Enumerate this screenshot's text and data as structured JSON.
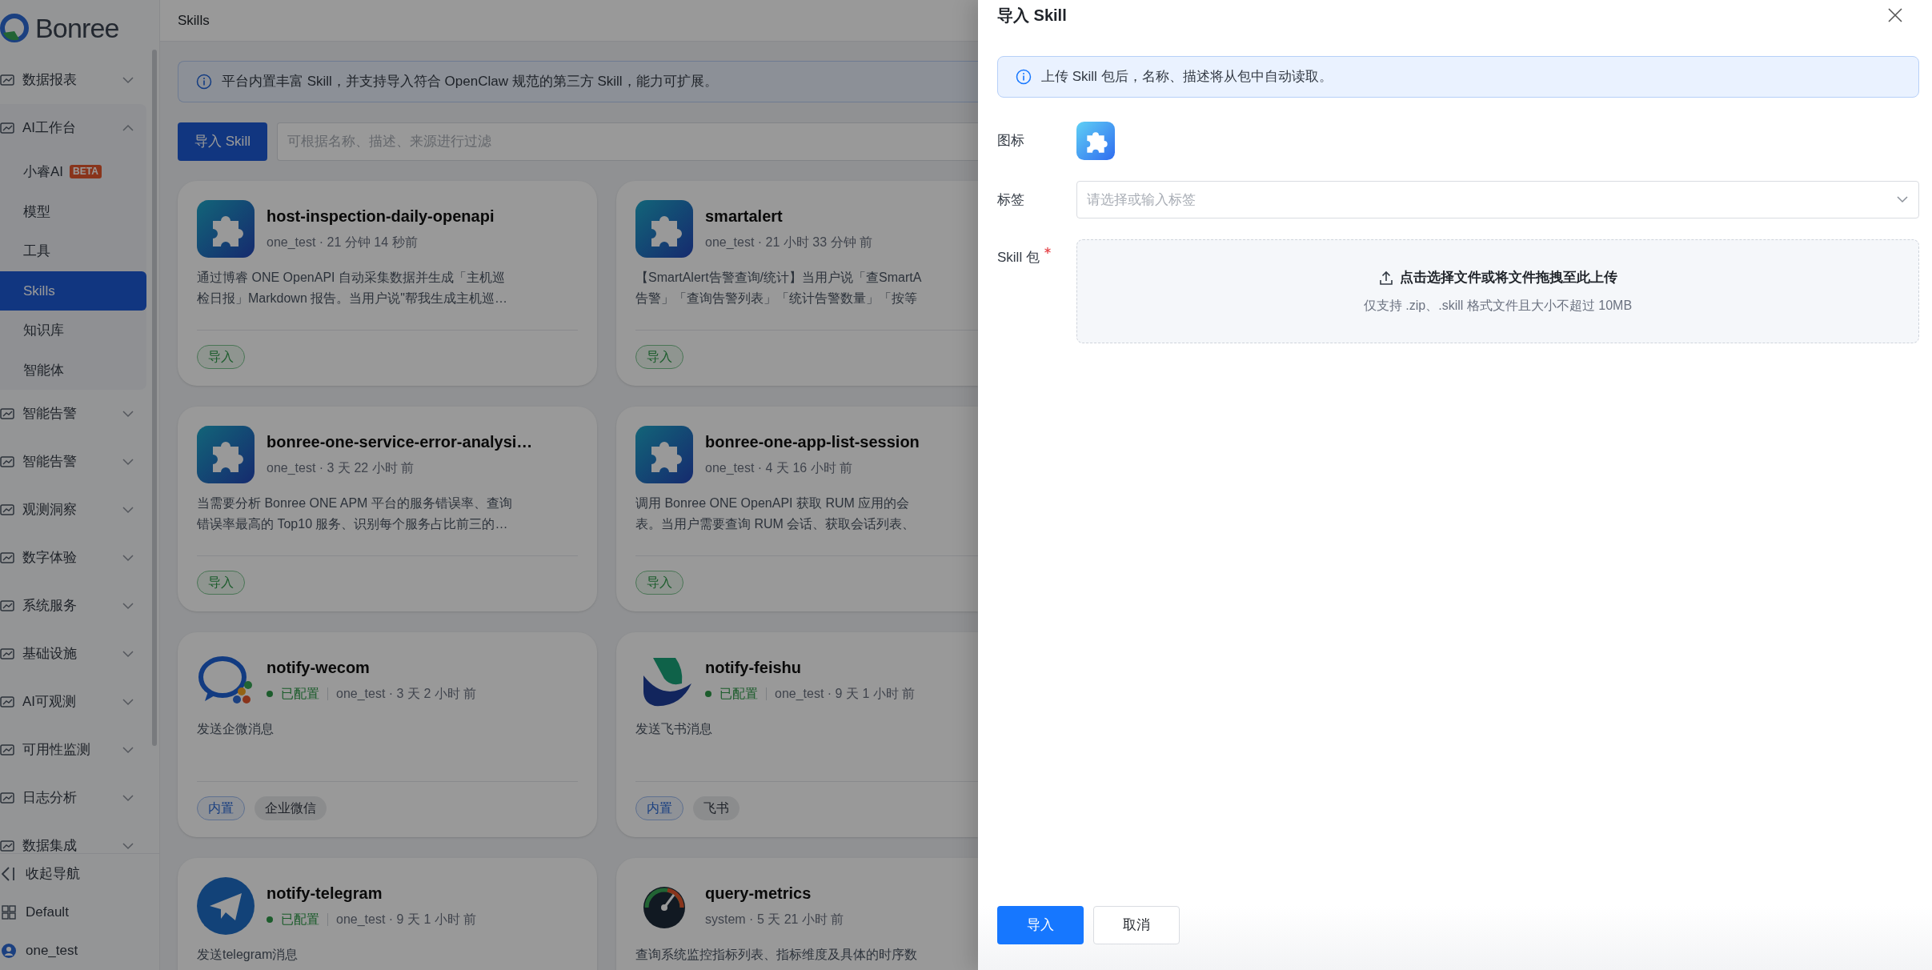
{
  "sidebar": {
    "logo": "Bonree",
    "nav": [
      {
        "label": "数据报表",
        "expanded": false
      },
      {
        "label": "AI工作台",
        "expanded": true,
        "children": [
          {
            "label": "小睿AI",
            "badge": "BETA",
            "selected": false
          },
          {
            "label": "模型",
            "selected": false
          },
          {
            "label": "工具",
            "selected": false
          },
          {
            "label": "Skills",
            "selected": true
          },
          {
            "label": "知识库",
            "selected": false
          },
          {
            "label": "智能体",
            "selected": false
          }
        ]
      },
      {
        "label": "智能告警",
        "expanded": false
      },
      {
        "label": "智能告警",
        "expanded": false
      },
      {
        "label": "观测洞察",
        "expanded": false
      },
      {
        "label": "数字体验",
        "expanded": false
      },
      {
        "label": "系统服务",
        "expanded": false
      },
      {
        "label": "基础设施",
        "expanded": false
      },
      {
        "label": "AI可观测",
        "expanded": false
      },
      {
        "label": "可用性监测",
        "expanded": false
      },
      {
        "label": "日志分析",
        "expanded": false
      },
      {
        "label": "数据集成",
        "expanded": false
      }
    ],
    "footer": [
      {
        "label": "收起导航",
        "kind": "collapse"
      },
      {
        "label": "Default",
        "kind": "workspace"
      },
      {
        "label": "one_test",
        "kind": "user"
      }
    ]
  },
  "page": {
    "title": "Skills",
    "notice": "平台内置丰富 Skill，并支持导入符合 OpenClaw 规范的第三方 Skill，能力可扩展。",
    "import_button": "导入 Skill",
    "search": {
      "placeholder": "可根据名称、描述、来源进行过滤"
    },
    "cards": [
      {
        "title": "host-inspection-daily-openapi",
        "meta": "one_test · 21 分钟 14 秒前",
        "description": [
          "通过博睿 ONE OpenAPI 自动采集数据并生成「主机巡",
          "检日报」Markdown 报告。当用户说\"帮我生成主机巡…"
        ],
        "tags": [
          {
            "label": "导入",
            "kind": "import"
          }
        ]
      },
      {
        "title": "smartalert",
        "meta": "one_test · 21 小时 33 分钟 前",
        "description": [
          "【SmartAlert告警查询/统计】当用户说「查SmartA",
          "告警」「查询告警列表」「统计告警数量」「按等"
        ],
        "tags": [
          {
            "label": "导入",
            "kind": "import"
          }
        ]
      },
      {
        "title": "bonree-one-service-error-analysi…",
        "meta": "one_test · 3 天 22 小时 前",
        "description": [
          "当需要分析 Bonree ONE APM 平台的服务错误率、查询",
          "错误率最高的 Top10 服务、识别每个服务占比前三的…"
        ],
        "tags": [
          {
            "label": "导入",
            "kind": "import"
          }
        ]
      },
      {
        "title": "bonree-one-app-list-session",
        "meta": "one_test · 4 天 16 小时 前",
        "description": [
          "调用 Bonree ONE OpenAPI 获取 RUM 应用的会",
          "表。当用户需要查询 RUM 会话、获取会话列表、"
        ],
        "tags": [
          {
            "label": "导入",
            "kind": "import"
          }
        ]
      },
      {
        "title": "notify-wecom",
        "status": "已配置",
        "meta": "one_test · 3 天 2 小时 前",
        "description": [
          "发送企微消息"
        ],
        "tags": [
          {
            "label": "内置",
            "kind": "builtin"
          },
          {
            "label": "企业微信",
            "kind": "category"
          }
        ]
      },
      {
        "title": "notify-feishu",
        "status": "已配置",
        "meta": "one_test · 9 天 1 小时 前",
        "description": [
          "发送飞书消息"
        ],
        "tags": [
          {
            "label": "内置",
            "kind": "builtin"
          },
          {
            "label": "飞书",
            "kind": "category"
          }
        ]
      },
      {
        "title": "notify-telegram",
        "status": "已配置",
        "meta": "one_test · 9 天 1 小时 前",
        "description": [
          "发送telegram消息"
        ]
      },
      {
        "title": "query-metrics",
        "meta": "system · 5 天 21 小时 前",
        "description": [
          "查询系统监控指标列表、指标维度及具体的时序数"
        ]
      }
    ]
  },
  "drawer": {
    "title": "导入 Skill",
    "notice": "上传 Skill 包后，名称、描述将从包中自动读取。",
    "fields": [
      {
        "label": "图标",
        "kind": "icon"
      },
      {
        "label": "标签",
        "kind": "select",
        "placeholder": "请选择或输入标签"
      },
      {
        "label": "Skill 包",
        "kind": "upload",
        "required": true,
        "prompt": "点击选择文件或将文件拖拽至此上传",
        "hint": "仅支持 .zip、.skill 格式文件且大小不超过 10MB"
      }
    ],
    "buttons": [
      {
        "label": "导入",
        "kind": "primary"
      },
      {
        "label": "取消",
        "kind": "default"
      }
    ]
  }
}
